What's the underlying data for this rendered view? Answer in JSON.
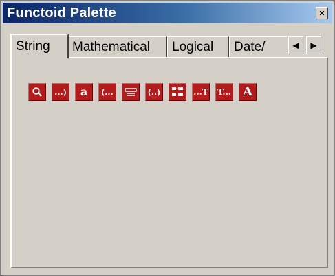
{
  "window": {
    "title": "Functoid Palette",
    "close_glyph": "×"
  },
  "tabs": [
    {
      "label": "String",
      "active": true
    },
    {
      "label": "Mathematical",
      "active": false
    },
    {
      "label": "Logical",
      "active": false
    },
    {
      "label": "Date/",
      "active": false
    }
  ],
  "tab_scroll": {
    "left_glyph": "◀",
    "right_glyph": "▶"
  },
  "functoids": [
    {
      "name": "string-find-icon",
      "glyph": "search"
    },
    {
      "name": "string-left-icon",
      "glyph": "...)"
    },
    {
      "name": "lowercase-icon",
      "glyph": "a"
    },
    {
      "name": "string-right-icon",
      "glyph": "(..."
    },
    {
      "name": "string-size-icon",
      "glyph": "size"
    },
    {
      "name": "string-extract-icon",
      "glyph": "(..)"
    },
    {
      "name": "string-concatenate-icon",
      "glyph": "concat"
    },
    {
      "name": "string-left-trim-icon",
      "glyph": "...T"
    },
    {
      "name": "string-right-trim-icon",
      "glyph": "T..."
    },
    {
      "name": "uppercase-icon",
      "glyph": "A"
    }
  ],
  "colors": {
    "title_start": "#0a246a",
    "title_end": "#a6caf0",
    "functoid_red": "#b51b1b",
    "face": "#d4d0c8"
  }
}
